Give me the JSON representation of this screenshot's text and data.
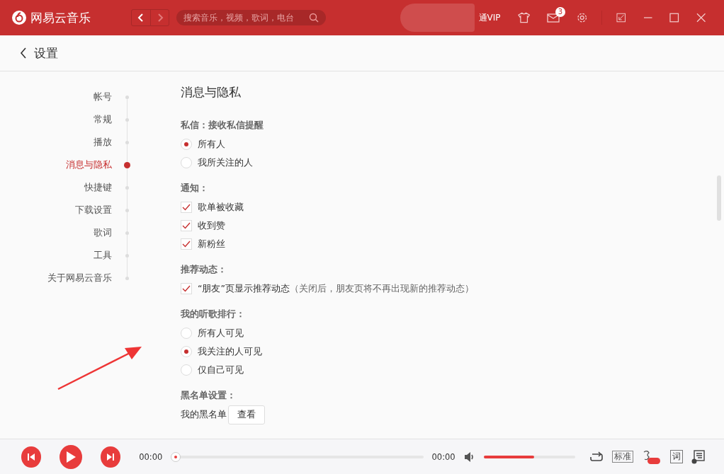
{
  "titlebar": {
    "app_name": "网易云音乐",
    "search": {
      "placeholder": "搜索音乐，视频，歌词，电台"
    },
    "vip_text": "通VIP",
    "mail_badge": "3"
  },
  "header": {
    "title": "设置"
  },
  "settings_nav": [
    {
      "label": "帐号",
      "selected": false
    },
    {
      "label": "常规",
      "selected": false
    },
    {
      "label": "播放",
      "selected": false
    },
    {
      "label": "消息与隐私",
      "selected": true
    },
    {
      "label": "快捷键",
      "selected": false
    },
    {
      "label": "下载设置",
      "selected": false
    },
    {
      "label": "歌词",
      "selected": false
    },
    {
      "label": "工具",
      "selected": false
    },
    {
      "label": "关于网易云音乐",
      "selected": false
    }
  ],
  "section_title": "消息与隐私",
  "groups": [
    {
      "label": "私信：接收私信提醒",
      "kind": "radio",
      "options": [
        {
          "label": "所有人",
          "selected": true
        },
        {
          "label": "我所关注的人",
          "selected": false
        }
      ]
    },
    {
      "label": "通知：",
      "kind": "checkbox",
      "options": [
        {
          "label": "歌单被收藏",
          "checked": true
        },
        {
          "label": "收到赞",
          "checked": true
        },
        {
          "label": "新粉丝",
          "checked": true
        }
      ]
    },
    {
      "label": "推荐动态：",
      "kind": "checkbox",
      "options": [
        {
          "label": "“朋友”页显示推荐动态",
          "note": "（关闭后，朋友页将不再出现新的推荐动态）",
          "checked": true
        }
      ]
    },
    {
      "label": "我的听歌排行：",
      "kind": "radio",
      "options": [
        {
          "label": "所有人可见",
          "selected": false
        },
        {
          "label": "我关注的人可见",
          "selected": true
        },
        {
          "label": "仅自己可见",
          "selected": false
        }
      ]
    },
    {
      "label": "黑名单设置：",
      "kind": "button",
      "text": "我的黑名单",
      "button": "查看"
    }
  ],
  "player": {
    "current_time": "00:00",
    "progress": {
      "level": 0
    },
    "total_time": "00:00",
    "volume": {
      "level": 0.55
    },
    "quality": "标准",
    "lyric_button": "词"
  }
}
